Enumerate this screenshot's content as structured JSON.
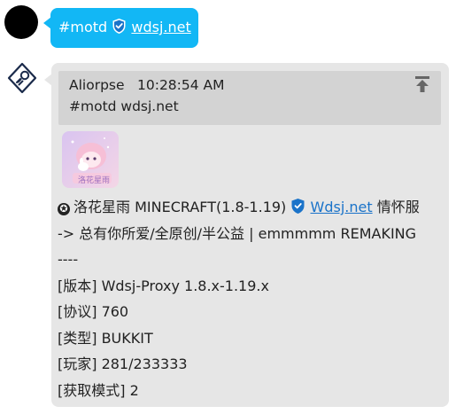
{
  "outgoing": {
    "text_prefix": "#motd",
    "link_text": "wdsj.net",
    "link_icon": "shield-check-icon"
  },
  "incoming": {
    "quote": {
      "sender": "Aliorpse",
      "time": "10:28:54 AM",
      "text": "#motd wdsj.net",
      "jump_icon": "jump-to-top-icon"
    },
    "server_icon_text": "洛花星雨",
    "motd_line1_prefix": "洛花星雨 MINECRAFT(1.8-1.19)",
    "motd_line1_link": "Wdsj.net",
    "motd_line1_suffix": "情怀服",
    "motd_line2": "-> 总有你所爱/全原创/半公益 | emmmmm REMAKING",
    "separator": "----",
    "version": "[版本] Wdsj-Proxy 1.8.x-1.19.x",
    "protocol": "[协议] 760",
    "type": "[类型] BUKKIT",
    "players": "[玩家] 281/233333",
    "mode": "[获取模式] 2"
  },
  "colors": {
    "outgoing_bubble": "#12b7f5",
    "incoming_bubble": "#e6e6e6",
    "quote_bg": "#d3d3d3",
    "link": "#1a73c9"
  }
}
